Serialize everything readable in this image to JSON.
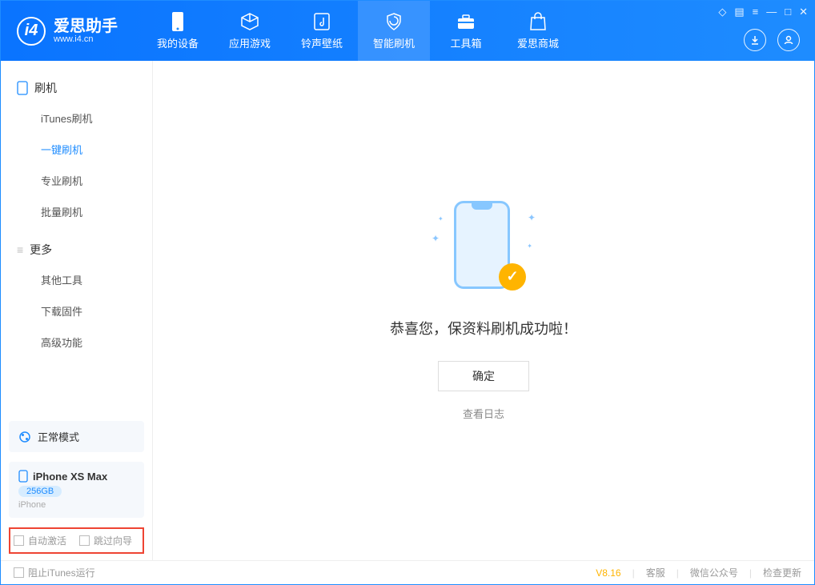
{
  "app": {
    "title": "爱思助手",
    "subtitle": "www.i4.cn"
  },
  "nav": {
    "device": "我的设备",
    "apps": "应用游戏",
    "ringtone": "铃声壁纸",
    "flash": "智能刷机",
    "toolbox": "工具箱",
    "store": "爱思商城"
  },
  "sidebar": {
    "section_flash": "刷机",
    "items_flash": {
      "itunes": "iTunes刷机",
      "onekey": "一键刷机",
      "pro": "专业刷机",
      "batch": "批量刷机"
    },
    "section_more": "更多",
    "items_more": {
      "other": "其他工具",
      "download": "下载固件",
      "advanced": "高级功能"
    },
    "mode": "正常模式",
    "device": {
      "name": "iPhone XS Max",
      "storage": "256GB",
      "type": "iPhone"
    },
    "checks": {
      "auto_activate": "自动激活",
      "skip_guide": "跳过向导"
    }
  },
  "main": {
    "message": "恭喜您，保资料刷机成功啦！",
    "ok": "确定",
    "view_log": "查看日志"
  },
  "footer": {
    "block_itunes": "阻止iTunes运行",
    "version": "V8.16",
    "support": "客服",
    "wechat": "微信公众号",
    "check_update": "检查更新"
  }
}
